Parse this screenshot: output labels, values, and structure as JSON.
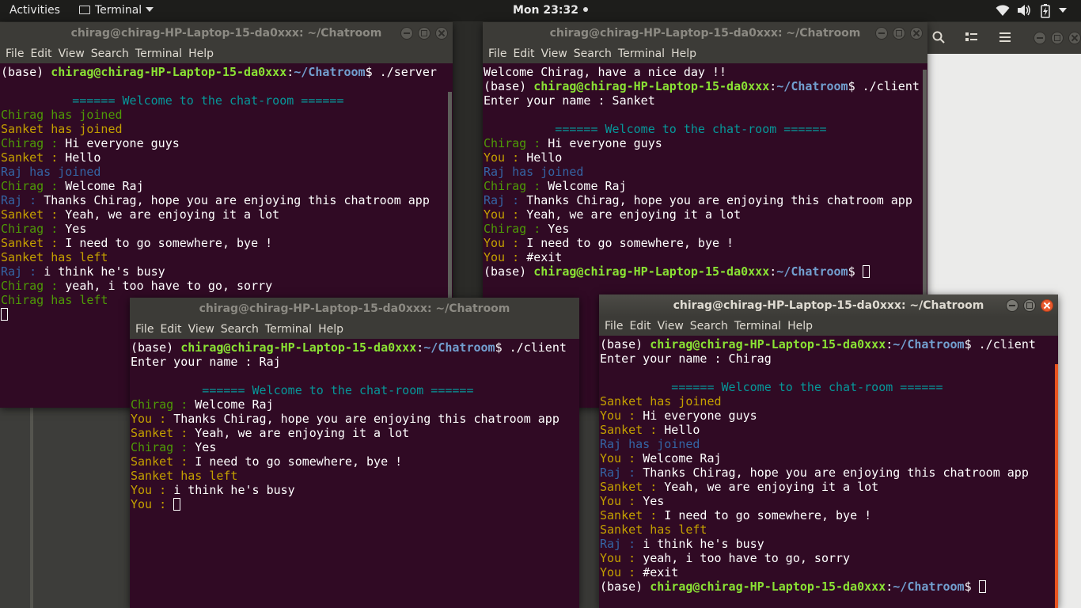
{
  "topbar": {
    "activities": "Activities",
    "app_name": "Terminal",
    "clock": "Mon 23:32"
  },
  "windows": {
    "server": {
      "title": "chirag@chirag-HP-Laptop-15-da0xxx: ~/Chatroom",
      "menu": [
        "File",
        "Edit",
        "View",
        "Search",
        "Terminal",
        "Help"
      ],
      "lines": [
        [
          {
            "t": "(base) "
          },
          {
            "t": "chirag@chirag-HP-Laptop-15-da0xxx",
            "c": "c-g"
          },
          {
            "t": ":"
          },
          {
            "t": "~/Chatroom",
            "c": "c-b"
          },
          {
            "t": "$ ./server"
          }
        ],
        [],
        [
          {
            "t": "          ====== Welcome to the chat-room ======",
            "c": "c-cy"
          }
        ],
        [
          {
            "t": "Chirag has joined",
            "c": "c-gr"
          }
        ],
        [
          {
            "t": "Sanket has joined",
            "c": "c-ye"
          }
        ],
        [
          {
            "t": "Chirag : ",
            "c": "c-gr"
          },
          {
            "t": "Hi everyone guys"
          }
        ],
        [
          {
            "t": "Sanket : ",
            "c": "c-ye"
          },
          {
            "t": "Hello"
          }
        ],
        [
          {
            "t": "Raj has joined",
            "c": "c-bl"
          }
        ],
        [
          {
            "t": "Chirag : ",
            "c": "c-gr"
          },
          {
            "t": "Welcome Raj"
          }
        ],
        [
          {
            "t": "Raj : ",
            "c": "c-bl"
          },
          {
            "t": "Thanks Chirag, hope you are enjoying this chatroom app"
          }
        ],
        [
          {
            "t": "Sanket : ",
            "c": "c-ye"
          },
          {
            "t": "Yeah, we are enjoying it a lot"
          }
        ],
        [
          {
            "t": "Chirag : ",
            "c": "c-gr"
          },
          {
            "t": "Yes"
          }
        ],
        [
          {
            "t": "Sanket : ",
            "c": "c-ye"
          },
          {
            "t": "I need to go somewhere, bye !"
          }
        ],
        [
          {
            "t": "Sanket has left",
            "c": "c-ye"
          }
        ],
        [
          {
            "t": "Raj : ",
            "c": "c-bl"
          },
          {
            "t": "i think he's busy"
          }
        ],
        [
          {
            "t": "Chirag : ",
            "c": "c-gr"
          },
          {
            "t": "yeah, i too have to go, sorry"
          }
        ],
        [
          {
            "t": "Chirag has left",
            "c": "c-gr"
          }
        ],
        [
          {
            "cursor": true
          }
        ]
      ]
    },
    "sanket": {
      "title": "chirag@chirag-HP-Laptop-15-da0xxx: ~/Chatroom",
      "menu": [
        "File",
        "Edit",
        "View",
        "Search",
        "Terminal",
        "Help"
      ],
      "lines": [
        [
          {
            "t": "Welcome Chirag, have a nice day !!"
          }
        ],
        [
          {
            "t": "(base) "
          },
          {
            "t": "chirag@chirag-HP-Laptop-15-da0xxx",
            "c": "c-g"
          },
          {
            "t": ":"
          },
          {
            "t": "~/Chatroom",
            "c": "c-b"
          },
          {
            "t": "$ ./client"
          }
        ],
        [
          {
            "t": "Enter your name : Sanket"
          }
        ],
        [],
        [
          {
            "t": "          ====== Welcome to the chat-room ======",
            "c": "c-cy"
          }
        ],
        [
          {
            "t": "Chirag : ",
            "c": "c-gr"
          },
          {
            "t": "Hi everyone guys"
          }
        ],
        [
          {
            "t": "You : ",
            "c": "c-ye"
          },
          {
            "t": "Hello"
          }
        ],
        [
          {
            "t": "Raj has joined",
            "c": "c-bl"
          }
        ],
        [
          {
            "t": "Chirag : ",
            "c": "c-gr"
          },
          {
            "t": "Welcome Raj"
          }
        ],
        [
          {
            "t": "Raj : ",
            "c": "c-bl"
          },
          {
            "t": "Thanks Chirag, hope you are enjoying this chatroom app"
          }
        ],
        [
          {
            "t": "You : ",
            "c": "c-ye"
          },
          {
            "t": "Yeah, we are enjoying it a lot"
          }
        ],
        [
          {
            "t": "Chirag : ",
            "c": "c-gr"
          },
          {
            "t": "Yes"
          }
        ],
        [
          {
            "t": "You : ",
            "c": "c-ye"
          },
          {
            "t": "I need to go somewhere, bye !"
          }
        ],
        [
          {
            "t": "You : ",
            "c": "c-ye"
          },
          {
            "t": "#exit"
          }
        ],
        [
          {
            "t": "(base) "
          },
          {
            "t": "chirag@chirag-HP-Laptop-15-da0xxx",
            "c": "c-g"
          },
          {
            "t": ":"
          },
          {
            "t": "~/Chatroom",
            "c": "c-b"
          },
          {
            "t": "$ "
          },
          {
            "cursor": true
          }
        ]
      ]
    },
    "raj": {
      "title": "chirag@chirag-HP-Laptop-15-da0xxx: ~/Chatroom",
      "menu": [
        "File",
        "Edit",
        "View",
        "Search",
        "Terminal",
        "Help"
      ],
      "lines": [
        [
          {
            "t": "(base) "
          },
          {
            "t": "chirag@chirag-HP-Laptop-15-da0xxx",
            "c": "c-g"
          },
          {
            "t": ":"
          },
          {
            "t": "~/Chatroom",
            "c": "c-b"
          },
          {
            "t": "$ ./client"
          }
        ],
        [
          {
            "t": "Enter your name : Raj"
          }
        ],
        [],
        [
          {
            "t": "          ====== Welcome to the chat-room ======",
            "c": "c-cy"
          }
        ],
        [
          {
            "t": "Chirag : ",
            "c": "c-gr"
          },
          {
            "t": "Welcome Raj"
          }
        ],
        [
          {
            "t": "You : ",
            "c": "c-ye"
          },
          {
            "t": "Thanks Chirag, hope you are enjoying this chatroom app"
          }
        ],
        [
          {
            "t": "Sanket : ",
            "c": "c-ye"
          },
          {
            "t": "Yeah, we are enjoying it a lot"
          }
        ],
        [
          {
            "t": "Chirag : ",
            "c": "c-gr"
          },
          {
            "t": "Yes"
          }
        ],
        [
          {
            "t": "Sanket : ",
            "c": "c-ye"
          },
          {
            "t": "I need to go somewhere, bye !"
          }
        ],
        [
          {
            "t": "Sanket has left",
            "c": "c-ye"
          }
        ],
        [
          {
            "t": "You : ",
            "c": "c-ye"
          },
          {
            "t": "i think he's busy"
          }
        ],
        [
          {
            "t": "You : ",
            "c": "c-ye"
          },
          {
            "cursor": true
          }
        ]
      ]
    },
    "chirag": {
      "title": "chirag@chirag-HP-Laptop-15-da0xxx: ~/Chatroom",
      "menu": [
        "File",
        "Edit",
        "View",
        "Search",
        "Terminal",
        "Help"
      ],
      "lines": [
        [
          {
            "t": "(base) "
          },
          {
            "t": "chirag@chirag-HP-Laptop-15-da0xxx",
            "c": "c-g"
          },
          {
            "t": ":"
          },
          {
            "t": "~/Chatroom",
            "c": "c-b"
          },
          {
            "t": "$ ./client"
          }
        ],
        [
          {
            "t": "Enter your name : Chirag"
          }
        ],
        [],
        [
          {
            "t": "          ====== Welcome to the chat-room ======",
            "c": "c-cy"
          }
        ],
        [
          {
            "t": "Sanket has joined",
            "c": "c-ye"
          }
        ],
        [
          {
            "t": "You : ",
            "c": "c-ye"
          },
          {
            "t": "Hi everyone guys"
          }
        ],
        [
          {
            "t": "Sanket : ",
            "c": "c-ye"
          },
          {
            "t": "Hello"
          }
        ],
        [
          {
            "t": "Raj has joined",
            "c": "c-bl"
          }
        ],
        [
          {
            "t": "You : ",
            "c": "c-ye"
          },
          {
            "t": "Welcome Raj"
          }
        ],
        [
          {
            "t": "Raj : ",
            "c": "c-bl"
          },
          {
            "t": "Thanks Chirag, hope you are enjoying this chatroom app"
          }
        ],
        [
          {
            "t": "Sanket : ",
            "c": "c-ye"
          },
          {
            "t": "Yeah, we are enjoying it a lot"
          }
        ],
        [
          {
            "t": "You : ",
            "c": "c-ye"
          },
          {
            "t": "Yes"
          }
        ],
        [
          {
            "t": "Sanket : ",
            "c": "c-ye"
          },
          {
            "t": "I need to go somewhere, bye !"
          }
        ],
        [
          {
            "t": "Sanket has left",
            "c": "c-ye"
          }
        ],
        [
          {
            "t": "Raj : ",
            "c": "c-bl"
          },
          {
            "t": "i think he's busy"
          }
        ],
        [
          {
            "t": "You : ",
            "c": "c-ye"
          },
          {
            "t": "yeah, i too have to go, sorry"
          }
        ],
        [
          {
            "t": "You : ",
            "c": "c-ye"
          },
          {
            "t": "#exit"
          }
        ],
        [
          {
            "t": "(base) "
          },
          {
            "t": "chirag@chirag-HP-Laptop-15-da0xxx",
            "c": "c-g"
          },
          {
            "t": ":"
          },
          {
            "t": "~/Chatroom",
            "c": "c-b"
          },
          {
            "t": "$ "
          },
          {
            "cursor": true
          }
        ]
      ]
    }
  },
  "colors": {
    "terminal_bg": "#300a24",
    "prompt_user": "#8ae234",
    "prompt_path": "#729fcf",
    "accent_orange": "#e95420"
  }
}
